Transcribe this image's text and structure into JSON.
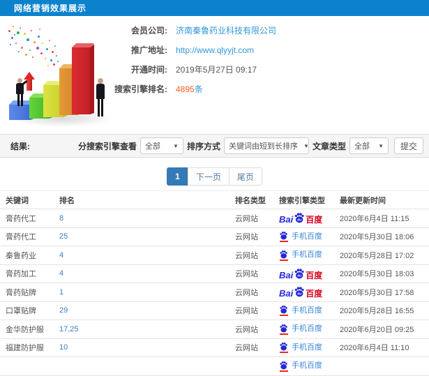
{
  "header": {
    "title": "网络营销效果展示"
  },
  "info": {
    "rows": [
      {
        "label": "会员公司:",
        "value": "济南秦鲁药业科技有限公司",
        "style": "link"
      },
      {
        "label": "推广地址:",
        "value": "http://www.qlyyjt.com",
        "style": "link"
      },
      {
        "label": "开通时间:",
        "value": "2019年5月27日 09:17",
        "style": "text"
      },
      {
        "label": "搜索引擎排名:",
        "value": "4895",
        "suffix": "条",
        "style": "count"
      }
    ]
  },
  "filters": {
    "result_label": "结果:",
    "engine_label": "分搜索引擎查看",
    "engine_value": "全部",
    "sort_label": "排序方式",
    "sort_value": "关键词由短到长排序",
    "article_label": "文章类型",
    "article_value": "全部",
    "submit_label": "提交",
    "caret": "▼"
  },
  "pagination": {
    "current": "1",
    "next_label": "下一页",
    "last_label": "尾页"
  },
  "table": {
    "columns": [
      "关键词",
      "排名",
      "排名类型",
      "搜索引擎类型",
      "最新更新时间"
    ],
    "rows": [
      {
        "keyword": "膏药代工",
        "rank": "8",
        "rank_type": "云网站",
        "engine": "baidu-pc",
        "updated": "2020年6月4日 11:15"
      },
      {
        "keyword": "膏药代工",
        "rank": "25",
        "rank_type": "云网站",
        "engine": "baidu-mobile",
        "updated": "2020年5月30日 18:06"
      },
      {
        "keyword": "秦鲁药业",
        "rank": "4",
        "rank_type": "云网站",
        "engine": "baidu-mobile",
        "updated": "2020年5月28日 17:02"
      },
      {
        "keyword": "膏药加工",
        "rank": "4",
        "rank_type": "云网站",
        "engine": "baidu-pc",
        "updated": "2020年5月30日 18:03"
      },
      {
        "keyword": "膏药贴牌",
        "rank": "1",
        "rank_type": "云网站",
        "engine": "baidu-pc",
        "updated": "2020年5月30日 17:58"
      },
      {
        "keyword": "口罩贴牌",
        "rank": "29",
        "rank_type": "云网站",
        "engine": "baidu-mobile",
        "updated": "2020年5月28日 16:55"
      },
      {
        "keyword": "金华防护服",
        "rank": "17,25",
        "rank_type": "云网站",
        "engine": "baidu-mobile",
        "updated": "2020年6月20日 09:25"
      },
      {
        "keyword": "福建防护服",
        "rank": "10",
        "rank_type": "云网站",
        "engine": "baidu-mobile",
        "updated": "2020年6月4日 11:10"
      },
      {
        "keyword": "",
        "rank": "",
        "rank_type": "",
        "engine": "baidu-mobile",
        "updated": ""
      }
    ],
    "engine_logos": {
      "baidu_pc": {
        "bai": "Bai",
        "du": "du",
        "cn": "百度"
      },
      "baidu_mobile": {
        "label": "手机百度"
      }
    }
  },
  "colors": {
    "titlebar_blue": "#0d82cc",
    "link_blue": "#3296d8",
    "count_orange": "#ff5a22",
    "pager_active_blue": "#337ab7",
    "baidu_blue": "#2429d8",
    "baidu_red": "#d9001b",
    "mobile_text_blue": "#3a85d8"
  }
}
